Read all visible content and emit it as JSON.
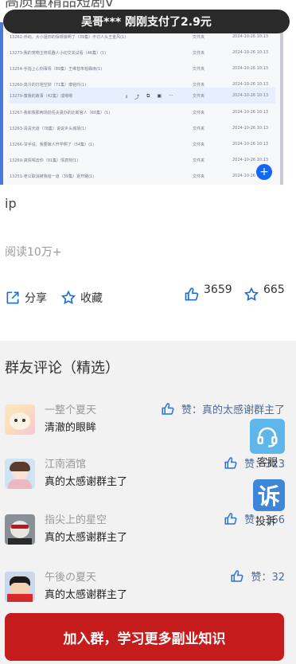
{
  "page": {
    "title_partial": "高质量精品短剧v",
    "toast": "吴哥*** 刚刚支付了2.9元",
    "ip_text": "ip",
    "read_count": "阅读10万+"
  },
  "preview": {
    "rows": [
      {
        "name": "13262-乔屿，大小姐你的保镖爆啊了（39集）不讨人头王金风(1)",
        "owner": "文件夹",
        "date": "2024-10-26 10:13"
      },
      {
        "name": "13273-我的宠物主修机器人小切艾关试看（46集）(1)",
        "owner": "文件夹",
        "date": "2024-10-26 10:13"
      },
      {
        "name": "13254-手指上心刻事情（89集）王维替朱柏霖雨(1)",
        "owner": "文件夹",
        "date": "2024-10-26 10:13"
      },
      {
        "name": "13260-高冷的灯塔空掉（71集）康铭吟(1)",
        "owner": "文件夹",
        "date": "2024-10-26 10:13"
      },
      {
        "name": "13279-童我的故事（42集）成嗯嗯",
        "owner": "文件夹",
        "date": "2024-10-26 10:13"
      },
      {
        "name": "13267-我和我那两场前任夫妻办的比新官人（60集）(1)",
        "owner": "文件夹",
        "date": "2024-10-26 10:13"
      },
      {
        "name": "13263-清清光道（78集）说说乡头城场(1)",
        "owner": "文件夹",
        "date": "2024-10-26 10:13"
      },
      {
        "name": "13266-甘手说，我要嫁人开学啊了（54集）(1)",
        "owner": "文件夹",
        "date": "2024-10-26 10:13"
      },
      {
        "name": "13269-真情喝去你（91集）情意刻(1)",
        "owner": "文件夹",
        "date": "2024-10-26 10:13"
      },
      {
        "name": "13251-老公取消被我给一道（39集）逐开路(1)",
        "owner": "文件夹",
        "date": "2024-10-26 10:13"
      }
    ],
    "fab": "+"
  },
  "actions": {
    "share_label": "分享",
    "fav_label": "收藏",
    "like_count": "3659",
    "star_count": "665"
  },
  "comments": {
    "title": "群友评论（精选）",
    "items": [
      {
        "name": "一整个夏天",
        "text": "清澈的眼眸",
        "like": "赞：真的太感谢群主了"
      },
      {
        "name": "江南酒馆",
        "text": "真的太感谢群主了",
        "like": "赞：323"
      },
      {
        "name": "指尖上的星空",
        "text": "真的太感谢群主了",
        "like": "赞：366"
      },
      {
        "name": "午後の夏天",
        "text": "真的太感谢群主了",
        "like": "赞：32"
      }
    ]
  },
  "side": {
    "kefu_label": "客服",
    "sue_glyph": "诉",
    "sue_label": "投诉"
  },
  "join_button": "加入群，学习更多副业知识",
  "colors": {
    "accent_blue": "#1466f5",
    "join_red": "#c51d1d",
    "like_blue": "#4d6b95"
  }
}
